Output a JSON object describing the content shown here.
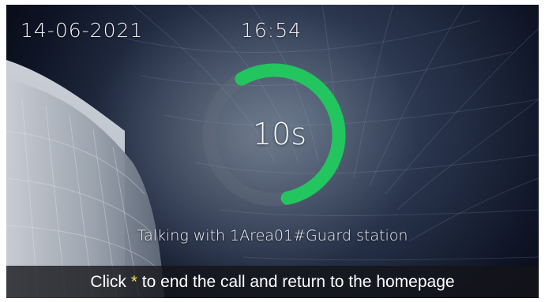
{
  "header": {
    "date": "14-06-2021",
    "time": "16:54"
  },
  "call": {
    "timer_label": "10s",
    "timer_progress": 0.55,
    "status": "Talking with 1Area01#Guard station"
  },
  "hint": {
    "prefix": "Click ",
    "key": "*",
    "suffix": " to end the call and return to the homepage"
  },
  "colors": {
    "ring_progress": "#22c55e",
    "ring_track": "#6b7280",
    "hint_key": "#f5e04a"
  }
}
